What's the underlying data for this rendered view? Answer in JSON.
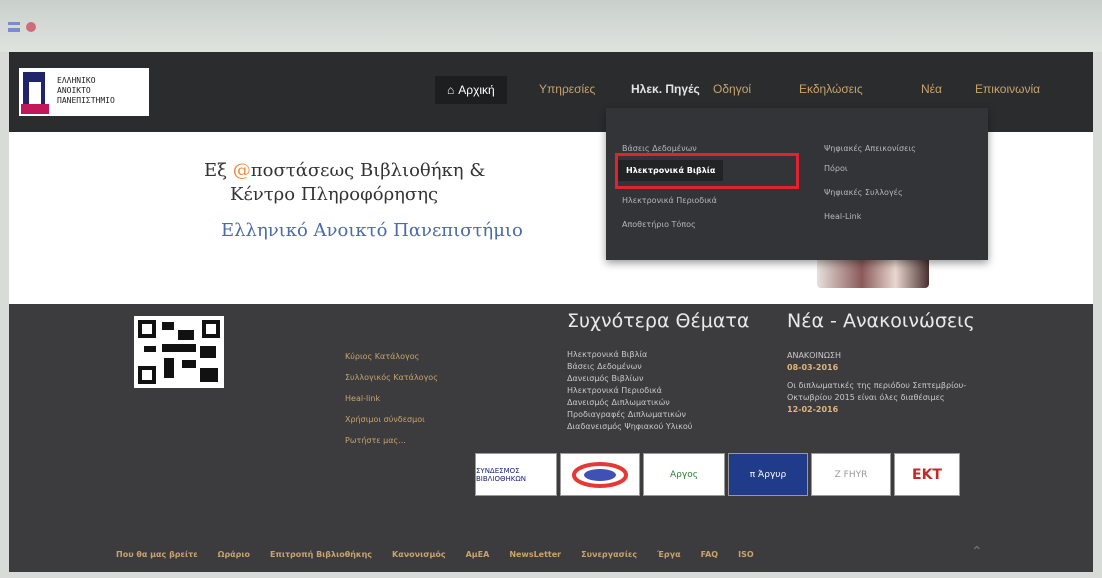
{
  "logo": {
    "line1": "ΕΛΛΗΝΙΚΟ",
    "line2": "ΑΝΟΙΚΤΟ",
    "line3": "ΠΑΝΕΠΙΣΤΗΜΙΟ"
  },
  "nav": {
    "home": "Αρχική",
    "items": [
      "Υπηρεσίες",
      "Ηλεκ. Πηγές",
      "Οδηγοί",
      "Εκδηλώσεις",
      "Νέα",
      "Επικοινωνία"
    ]
  },
  "hero": {
    "title_part1": "Εξ ",
    "title_at": "@",
    "title_part2": "ποστάσεως Βιβλιοθήκη &",
    "title_line2": "Κέντρο Πληροφόρησης",
    "subtitle": "Ελληνικό Ανοικτό Πανεπιστήμιο"
  },
  "dropdown": {
    "col1": [
      "Βάσεις Δεδομένων",
      "Ηλεκτρονικά Βιβλία",
      "Ηλεκτρονικά Περιοδικά",
      "Αποθετήριο Τόπος"
    ],
    "col2": [
      "Ψηφιακές Απεικονίσεις",
      "Πόροι",
      "Ψηφιακές Συλλογές",
      "Heal-Link"
    ],
    "highlighted": "Ηλεκτρονικά Βιβλία"
  },
  "footer": {
    "links1": [
      "Κύριος Κατάλογος",
      "Συλλογικός Κατάλογος",
      "Heal-link",
      "Χρήσιμοι σύνδεσμοι",
      "Ρωτήστε μας..."
    ],
    "popular_title": "Συχνότερα Θέματα",
    "popular": [
      "Ηλεκτρονικά Βιβλία",
      "Βάσεις Δεδομένων",
      "Δανεισμός Βιβλίων",
      "Ηλεκτρονικά Περιοδικά",
      "Δανεισμός Διπλωματικών",
      "Προδιαγραφές Διπλωματικών",
      "Διαδανεισμός Ψηφιακού Υλικού"
    ],
    "news_title": "Νέα - Ανακοινώσεις",
    "news": [
      {
        "label": "ΑΝΑΚΟΙΝΩΣΗ",
        "date": "08-03-2016",
        "text": "Οι διπλωματικές της περιόδου Σεπτεμβρίου-Οκτωβρίου 2015 είναι όλες διαθέσιμες"
      },
      {
        "label": "",
        "date": "12-02-2016",
        "text": ""
      }
    ],
    "partners": [
      "ΣΥΝΔΕΣΜΟΣ ΒΙΒΛΙΟΘΗΚΩΝ",
      "",
      "Αργος",
      "π Άργυρ",
      "Z FHYR",
      "EKT"
    ],
    "bottom_links": [
      "Που θα μας βρείτε",
      "Ωράριο",
      "Επιτροπή Βιβλιοθήκης",
      "Κανονισμός",
      "ΑμΕΑ",
      "NewsLetter",
      "Συνεργασίες",
      "Έργα",
      "FAQ",
      "ISO"
    ]
  },
  "colors": {
    "navbar": "#2b2c2e",
    "footer": "#3c3c3e",
    "highlight": "#e0232c",
    "gold": "#c9a36b"
  }
}
